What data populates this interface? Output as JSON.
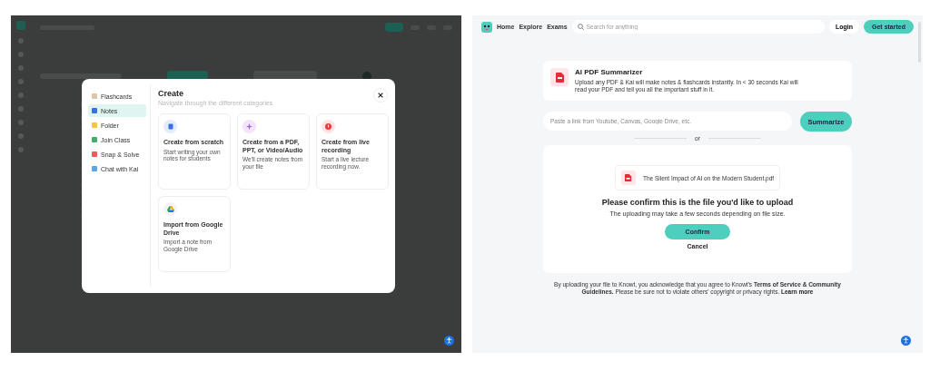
{
  "left_screen": {
    "modal": {
      "sidebar": [
        {
          "kind": "flashcards",
          "label": "Flashcards",
          "selected": false
        },
        {
          "kind": "notes",
          "label": "Notes",
          "selected": true
        },
        {
          "kind": "folder",
          "label": "Folder",
          "selected": false
        },
        {
          "kind": "class",
          "label": "Join Class",
          "selected": false
        },
        {
          "kind": "snap",
          "label": "Snap & Solve",
          "selected": false
        },
        {
          "kind": "chat",
          "label": "Chat with Kai",
          "selected": false
        }
      ],
      "title": "Create",
      "subtitle": "Navigate through the different categories",
      "options": [
        {
          "kind": "scratch",
          "title": "Create from scratch",
          "description": "Start writing your own notes for students"
        },
        {
          "kind": "upload",
          "title": "Create from a PDF, PPT, or Video/Audio",
          "description": "We'll create notes from your file"
        },
        {
          "kind": "record",
          "title": "Create from live recording",
          "description": "Start a live lecture recording now."
        },
        {
          "kind": "drive",
          "title": "Import from Google Drive",
          "description": "Import a note from Google Drive"
        }
      ]
    }
  },
  "right_screen": {
    "nav": {
      "links": [
        "Home",
        "Explore",
        "Exams"
      ],
      "search_placeholder": "Search for anything",
      "login": "Login",
      "get_started": "Get started"
    },
    "intro": {
      "title": "AI PDF Summarizer",
      "text": "Upload any PDF & Kai will make notes & flashcards instantly. In < 30 seconds Kai will read your PDF and tell you all the important stuff in it."
    },
    "link_field": {
      "placeholder": "Paste a link from Youtube, Canvas, Google Drive, etc."
    },
    "summarize": "Summarize",
    "divider": "or",
    "upload": {
      "file_name": "The Silent Impact of AI on the Modern Student.pdf",
      "heading": "Please confirm this is the file you'd like to upload",
      "note": "The uploading may take a few seconds depending on file size.",
      "confirm": "Confirm",
      "cancel": "Cancel"
    },
    "footer": {
      "text": "By uploading your file to Knowt, you acknowledge that you agree to Knowt's **Terms of Service & Community Guidelines.** Please be sure not to violate others' copyright or privacy rights.",
      "link": "Learn more"
    }
  }
}
